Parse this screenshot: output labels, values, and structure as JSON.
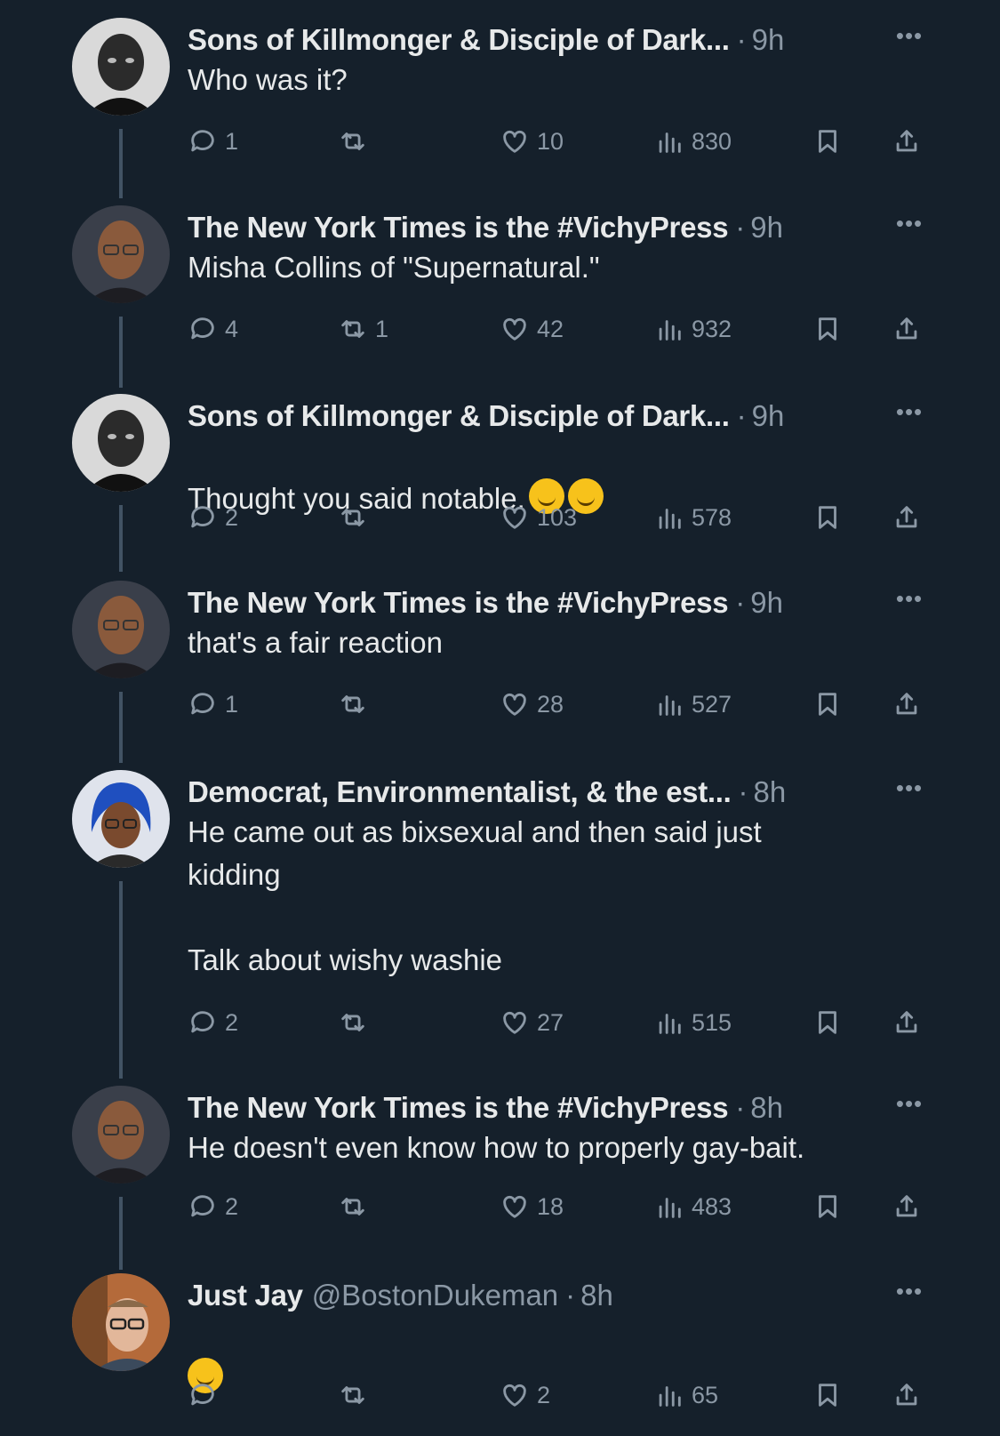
{
  "tweets": [
    {
      "name": "Sons of Killmonger & Disciple of Dark...",
      "handle": "",
      "time": "9h",
      "text": "Who was it?",
      "replies": "1",
      "retweets": "",
      "likes": "10",
      "views": "830",
      "avatar_style": "bw-portrait"
    },
    {
      "name": "The New York Times is the #VichyPress",
      "handle": "",
      "time": "9h",
      "text": "Misha Collins of \"Supernatural.\"",
      "replies": "4",
      "retweets": "1",
      "likes": "42",
      "views": "932",
      "avatar_style": "bald-glasses"
    },
    {
      "name": "Sons of Killmonger & Disciple of Dark...",
      "handle": "",
      "time": "9h",
      "text": "Thought you said notable.",
      "emoji": [
        "rolling-on-floor-laughing",
        "rolling-on-floor-laughing"
      ],
      "replies": "2",
      "retweets": "",
      "likes": "103",
      "views": "578",
      "avatar_style": "bw-portrait"
    },
    {
      "name": "The New York Times is the #VichyPress",
      "handle": "",
      "time": "9h",
      "text": "that's a fair reaction",
      "replies": "1",
      "retweets": "",
      "likes": "28",
      "views": "527",
      "avatar_style": "bald-glasses"
    },
    {
      "name": "Democrat, Environmentalist, & the est...",
      "handle": "",
      "time": "8h",
      "text": "He came out as bixsexual and then said just\nkidding\n\nTalk about wishy washie",
      "replies": "2",
      "retweets": "",
      "likes": "27",
      "views": "515",
      "avatar_style": "blue-hair-avatar"
    },
    {
      "name": "The New York Times is the #VichyPress",
      "handle": "",
      "time": "8h",
      "text": "He doesn't even know how to properly gay-bait.",
      "replies": "2",
      "retweets": "",
      "likes": "18",
      "views": "483",
      "avatar_style": "bald-glasses"
    },
    {
      "name": "Just Jay",
      "handle": "@BostonDukeman",
      "time": "8h",
      "text": "",
      "emoji": [
        "smirking-face"
      ],
      "replies": "",
      "retweets": "",
      "likes": "2",
      "views": "65",
      "avatar_style": "glasses-photo"
    }
  ],
  "icons": {
    "reply": "reply-icon",
    "retweet": "retweet-icon",
    "like": "heart-icon",
    "views": "views-icon",
    "bookmark": "bookmark-icon",
    "share": "share-icon",
    "more": "more-icon"
  },
  "colors": {
    "background": "#15202b",
    "text": "#e7e9ea",
    "secondary": "#8b98a5",
    "thread_line": "#425364"
  }
}
